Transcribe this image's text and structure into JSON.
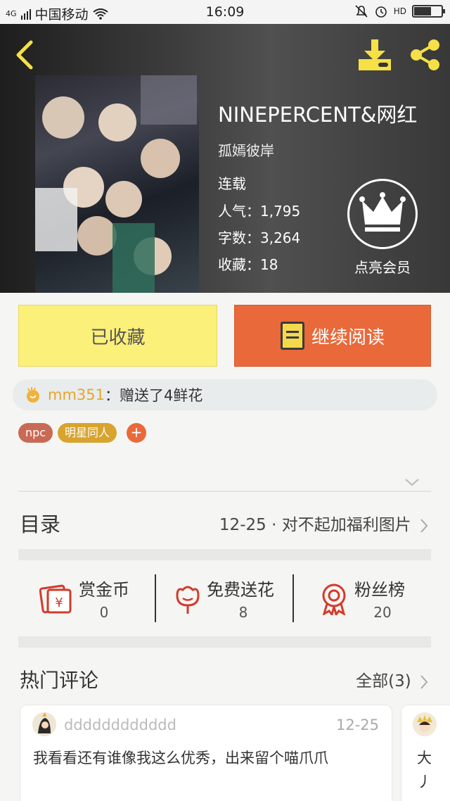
{
  "status_bar": {
    "carrier": "中国移动",
    "network": "4G",
    "time": "16:09",
    "hd": "HD"
  },
  "book": {
    "title": "NINEPERCENT&网红",
    "author": "孤嫣彼岸",
    "status": "连载",
    "popularity_label": "人气：",
    "popularity": "1,795",
    "words_label": "字数：",
    "words": "3,264",
    "favorites_label": "收藏：",
    "favorites": "18",
    "vip_label": "点亮会员"
  },
  "actions": {
    "collected_label": "已收藏",
    "continue_label": "继续阅读"
  },
  "gift_notice": {
    "user": "mm351",
    "message": "：赠送了4鲜花"
  },
  "tags": [
    "npc",
    "明星同人"
  ],
  "tag_colors": [
    "#c86a54",
    "#d8a32e"
  ],
  "toc": {
    "label": "目录",
    "latest": "12-25 · 对不起加福利图片"
  },
  "metrics": [
    {
      "label": "赏金币",
      "value": "0",
      "icon": "red-envelope-yen-icon"
    },
    {
      "label": "免费送花",
      "value": "8",
      "icon": "flower-icon"
    },
    {
      "label": "粉丝榜",
      "value": "20",
      "icon": "ribbon-badge-icon"
    }
  ],
  "hot_comments": {
    "label": "热门评论",
    "all_label": "全部(3)",
    "items": [
      {
        "user": "dddddddddddd",
        "date": "12-25",
        "text": "我看看还有谁像我这么优秀，出来留个喵爪爪"
      },
      {
        "text": "大丿"
      }
    ]
  },
  "colors": {
    "accent_yellow": "#f5e046",
    "collected_bg": "#fbf07a",
    "read_bg": "#e9693a",
    "gift_user": "#e8a52b",
    "metric_icon": "#d23b2b"
  }
}
